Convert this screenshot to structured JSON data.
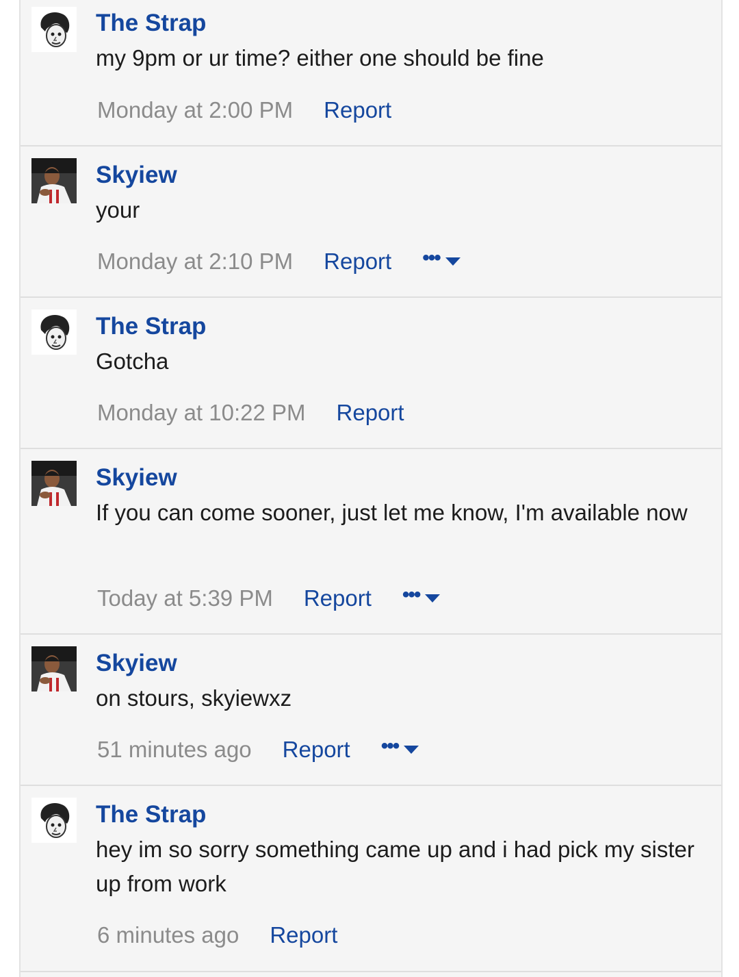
{
  "colors": {
    "link": "#15479e",
    "muted": "#8b8b8b",
    "text": "#1c1c1c",
    "panel": "#f5f5f5",
    "divider": "#dedede"
  },
  "messages": [
    {
      "author": "The Strap",
      "avatar": "sketch-avatar",
      "text": "my 9pm or ur time? either one should be fine",
      "time": "Monday at 2:00 PM",
      "report": "Report",
      "more": false
    },
    {
      "author": "Skyiew",
      "avatar": "photo-avatar",
      "text": "your",
      "time": "Monday at 2:10 PM",
      "report": "Report",
      "more": true,
      "more_label": "•••"
    },
    {
      "author": "The Strap",
      "avatar": "sketch-avatar",
      "text": "Gotcha",
      "time": "Monday at 10:22 PM",
      "report": "Report",
      "more": false
    },
    {
      "author": "Skyiew",
      "avatar": "photo-avatar",
      "text": "If you can come sooner, just let me know, I'm available now",
      "time": "Today at 5:39 PM",
      "report": "Report",
      "more": true,
      "more_label": "•••"
    },
    {
      "author": "Skyiew",
      "avatar": "photo-avatar",
      "text": "on stours, skyiewxz",
      "time": "51 minutes ago",
      "report": "Report",
      "more": true,
      "more_label": "•••"
    },
    {
      "author": "The Strap",
      "avatar": "sketch-avatar",
      "text": "hey im so sorry something came up and i had pick my sister up from work",
      "time": "6 minutes ago",
      "report": "Report",
      "more": false
    }
  ]
}
